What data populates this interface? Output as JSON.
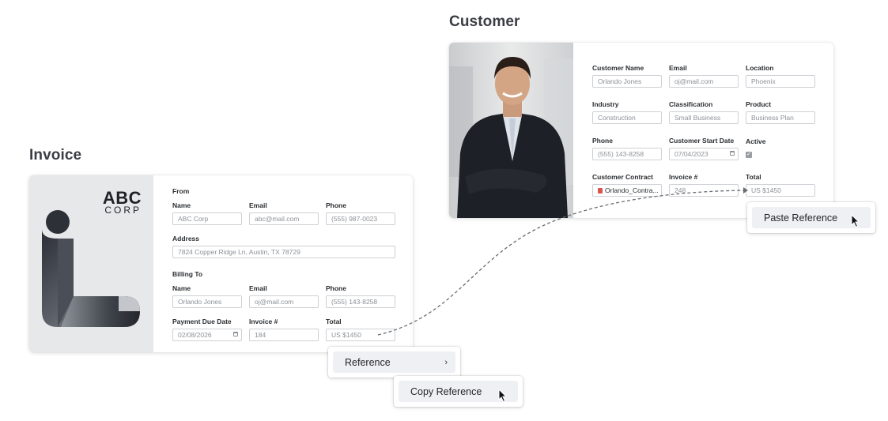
{
  "invoice": {
    "heading": "Invoice",
    "logo": {
      "line1": "ABC",
      "line2": "CORP"
    },
    "from_label": "From",
    "from": {
      "name_label": "Name",
      "name_value": "ABC Corp",
      "email_label": "Email",
      "email_value": "abc@mail.com",
      "phone_label": "Phone",
      "phone_value": "(555) 987-0023",
      "address_label": "Address",
      "address_value": "7824 Copper Ridge Ln, Austin, TX 78729"
    },
    "billing_label": "Billing To",
    "billing": {
      "name_label": "Name",
      "name_value": "Orlando Jones",
      "email_label": "Email",
      "email_value": "oj@mail.com",
      "phone_label": "Phone",
      "phone_value": "(555) 143-8258"
    },
    "due_label": "Payment Due Date",
    "due_value": "02/08/2026",
    "invoice_no_label": "Invoice #",
    "invoice_no_value": "184",
    "total_label": "Total",
    "total_value": "US $1450"
  },
  "customer": {
    "heading": "Customer",
    "name_label": "Customer Name",
    "name_value": "Orlando Jones",
    "email_label": "Email",
    "email_value": "oj@mail.com",
    "location_label": "Location",
    "location_value": "Phoenix",
    "industry_label": "Industry",
    "industry_value": "Construction",
    "classification_label": "Classification",
    "classification_value": "Small Business",
    "product_label": "Product",
    "product_value": "Business Plan",
    "phone_label": "Phone",
    "phone_value": "(555) 143-8258",
    "start_label": "Customer Start Date",
    "start_value": "07/04/2023",
    "active_label": "Active",
    "active_checked": true,
    "contract_label": "Customer Contract",
    "contract_value": "Orlando_Contra...",
    "invoice_no_label": "Invoice #",
    "invoice_no_value": "248",
    "total_label": "Total",
    "total_value": "US $1450"
  },
  "menus": {
    "reference_label": "Reference",
    "copy_reference_label": "Copy Reference",
    "paste_reference_label": "Paste Reference"
  },
  "icons": {
    "calendar": "calendar-icon",
    "chevron": "chevron-right-icon",
    "cursor": "mouse-pointer-icon",
    "pdf": "pdf-file-icon",
    "check": "checkmark-icon"
  },
  "colors": {
    "panel_gray": "#e7e8ea",
    "input_border": "#cdd0d4",
    "menu_highlight": "#eef0f3",
    "connector": "#6a6d72"
  }
}
